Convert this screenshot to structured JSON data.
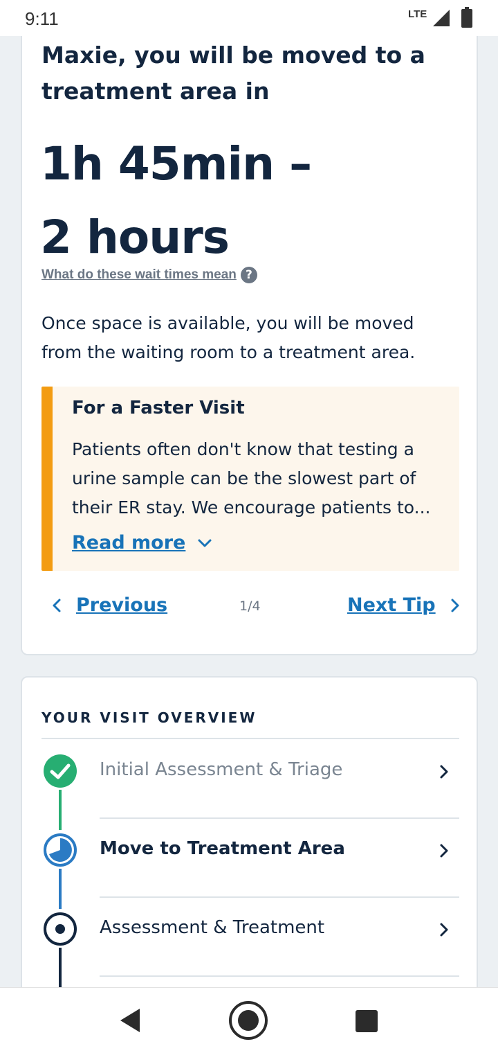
{
  "status_bar": {
    "time": "9:11",
    "network": "LTE"
  },
  "wait_card": {
    "greeting": "Maxie, you will be moved to a treatment area in",
    "wait_time_line1": "1h 45min –",
    "wait_time_line2": "2 hours",
    "wait_link": "What do these wait times mean",
    "help_icon": "?",
    "intro": "Once space is available, you will be moved from the waiting room to a treatment area.",
    "tip": {
      "title": "For a Faster Visit",
      "body": "Patients often don't know that testing a urine sample can be the slowest part of their ER stay. We encourage patients to...",
      "read_more": "Read more"
    },
    "pager": {
      "previous": "Previous",
      "indicator": "1/4",
      "next": "Next Tip"
    }
  },
  "overview": {
    "title": "YOUR VISIT OVERVIEW",
    "steps": [
      {
        "label": "Initial Assessment & Triage",
        "status": "complete"
      },
      {
        "label": "Move to Treatment Area",
        "status": "current"
      },
      {
        "label": "Assessment & Treatment",
        "status": "upcoming"
      }
    ]
  },
  "colors": {
    "accent_link": "#1873b8",
    "tip_bar": "#f39c12",
    "complete": "#27ae72",
    "current": "#2b7bc4",
    "upcoming": "#13263f"
  },
  "icons": {
    "help": "help-circle-icon",
    "read_more": "chevron-down-icon",
    "previous": "chevron-left-icon",
    "next": "chevron-right-icon",
    "complete_step": "check-circle-icon",
    "current_step": "clock-progress-icon",
    "upcoming_step": "target-circle-icon"
  }
}
